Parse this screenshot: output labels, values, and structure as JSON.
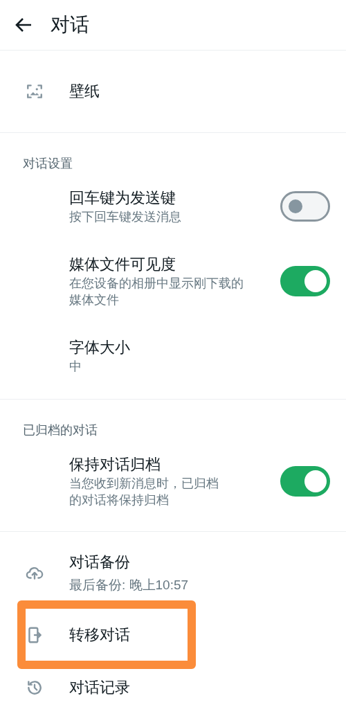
{
  "header": {
    "title": "对话"
  },
  "sections": [
    {
      "items": [
        {
          "kind": "link",
          "title": "壁纸",
          "highlighted": false
        }
      ]
    },
    {
      "heading": "对话设置",
      "items": [
        {
          "kind": "toggle",
          "title": "回车键为发送键",
          "subtitle": [
            "按下回车键发送消息"
          ],
          "on": false
        },
        {
          "kind": "toggle",
          "title": "媒体文件可见度",
          "subtitle": [
            "在您设备的相册中显示刚下载的",
            "媒体文件"
          ],
          "on": true
        },
        {
          "kind": "value",
          "title": "字体大小",
          "subtitle": [
            "中"
          ]
        }
      ]
    },
    {
      "heading": "已归档的对话",
      "items": [
        {
          "kind": "toggle",
          "title": "保持对话归档",
          "subtitle": [
            "当您收到新消息时，已归档",
            "的对话将保持归档"
          ],
          "on": true
        }
      ]
    },
    {
      "items": [
        {
          "kind": "link",
          "title": "对话备份",
          "subtitle": [
            "最后备份: 晚上10:57"
          ],
          "highlighted": false
        },
        {
          "kind": "link",
          "title": "转移对话",
          "highlighted": true
        },
        {
          "kind": "link",
          "title": "对话记录",
          "highlighted": false
        }
      ]
    }
  ]
}
